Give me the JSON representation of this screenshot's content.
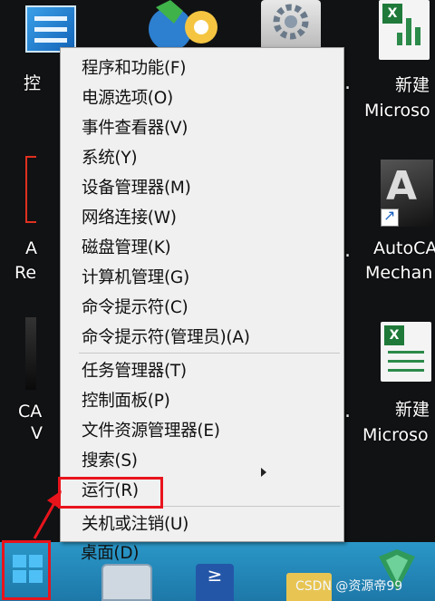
{
  "desktop": {
    "icons": [
      {
        "label": "控",
        "icon": "control-panel-icon"
      },
      {
        "label": "",
        "icon": "network-icon"
      },
      {
        "label": "",
        "icon": "settings-gear-icon"
      },
      {
        "label": "新建\nMicroso",
        "icon": "excel-file-icon"
      },
      {
        "label": "A\nRe",
        "icon": "cad-file-icon"
      },
      {
        "label": "AutoCA\nMechan",
        "icon": "autocad-icon"
      },
      {
        "label": "CA\nV",
        "icon": "cad-viewer-icon"
      },
      {
        "label": "新建\nMicroso",
        "icon": "excel-file-icon"
      }
    ],
    "dots": [
      ".",
      ".",
      ".",
      "."
    ]
  },
  "menu": {
    "items": [
      {
        "label": "程序和功能(F)"
      },
      {
        "label": "电源选项(O)"
      },
      {
        "label": "事件查看器(V)"
      },
      {
        "label": "系统(Y)"
      },
      {
        "label": "设备管理器(M)"
      },
      {
        "label": "网络连接(W)"
      },
      {
        "label": "磁盘管理(K)"
      },
      {
        "label": "计算机管理(G)"
      },
      {
        "label": "命令提示符(C)"
      },
      {
        "label": "命令提示符(管理员)(A)"
      },
      {
        "label": "任务管理器(T)"
      },
      {
        "label": "控制面板(P)"
      },
      {
        "label": "文件资源管理器(E)"
      },
      {
        "label": "搜索(S)"
      },
      {
        "label": "运行(R)"
      },
      {
        "label": "关机或注销(U)"
      },
      {
        "label": "桌面(D)"
      }
    ],
    "submenu_arrow": "chevron-right-icon"
  },
  "taskbar": {
    "start_icon": "windows-logo-icon",
    "apps": [
      "briefcase-icon",
      "powershell-icon",
      "folder-icon",
      "app-icon"
    ]
  },
  "annotations": {
    "highlight_color": "#e8141c"
  },
  "watermark": "CSDN @资源帝99",
  "colors": {
    "taskbar": "#1d78a8",
    "menu_bg": "#f0f0f0"
  }
}
